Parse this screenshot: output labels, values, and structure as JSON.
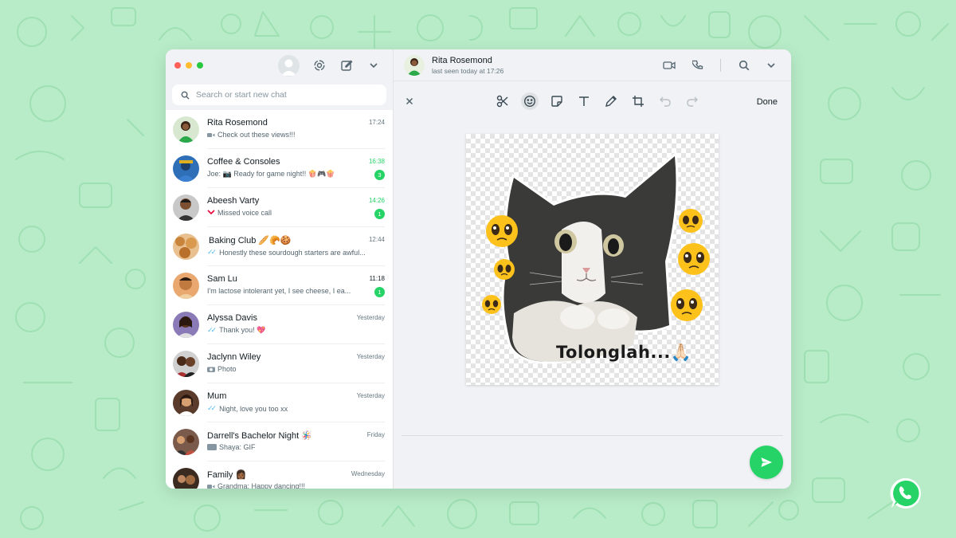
{
  "colors": {
    "background": "#b8ecc8",
    "accent_green": "#25d366",
    "read_tick": "#53bdeb"
  },
  "window": {
    "controls": [
      "close",
      "minimize",
      "zoom"
    ]
  },
  "sidebar_header": {
    "icons": [
      "profile-avatar-icon",
      "status-icon",
      "new-chat-icon",
      "chevron-down-icon"
    ]
  },
  "search": {
    "placeholder": "Search or start new chat"
  },
  "chats": [
    {
      "name": "Rita Rosemond",
      "time": "17:24",
      "preview": "Check out these views!!!",
      "preview_icon": "video-icon",
      "unread": ""
    },
    {
      "name": "Coffee & Consoles",
      "time": "16:38",
      "preview": "Joe: 📷 Ready for game night!! 🍿🎮🍿",
      "preview_icon": "",
      "unread": "3"
    },
    {
      "name": "Abeesh Varty",
      "time": "14:26",
      "preview": "Missed voice call",
      "preview_icon": "missed-call-icon",
      "unread": "1"
    },
    {
      "name": "Baking Club 🥖🥐🍪",
      "time": "12:44",
      "preview": "Honestly these sourdough starters are awful...",
      "preview_icon": "double-tick-icon",
      "unread": ""
    },
    {
      "name": "Sam Lu",
      "time": "11:18",
      "preview": "I'm lactose intolerant yet, I see cheese, I ea...",
      "preview_icon": "",
      "unread": "1"
    },
    {
      "name": "Alyssa Davis",
      "time": "Yesterday",
      "preview": "Thank you! 💖",
      "preview_icon": "double-tick-icon",
      "unread": ""
    },
    {
      "name": "Jaclynn Wiley",
      "time": "Yesterday",
      "preview": "Photo",
      "preview_icon": "camera-icon",
      "unread": ""
    },
    {
      "name": "Mum",
      "time": "Yesterday",
      "preview": "Night, love you too xx",
      "preview_icon": "double-tick-icon",
      "unread": ""
    },
    {
      "name": "Darrell's Bachelor Night 🪅",
      "time": "Friday",
      "preview": "Shaya: GIF",
      "preview_icon": "gif-icon",
      "unread": ""
    },
    {
      "name": "Family 👩🏾",
      "time": "Wednesday",
      "preview": "Grandma: Happy dancing!!!",
      "preview_icon": "video-icon",
      "unread": ""
    }
  ],
  "conversation": {
    "contact_name": "Rita Rosemond",
    "status": "last seen today at 17:26",
    "header_icons": [
      "video-call-icon",
      "voice-call-icon",
      "search-icon",
      "chevron-down-icon"
    ]
  },
  "editor": {
    "tools": [
      "scissors-icon",
      "emoji-icon",
      "sticker-icon",
      "text-icon",
      "pencil-icon",
      "crop-icon",
      "undo-icon",
      "redo-icon"
    ],
    "active_tool": "emoji-icon",
    "done_label": "Done",
    "sticker_caption": "Tolonglah...🙏🏻"
  }
}
